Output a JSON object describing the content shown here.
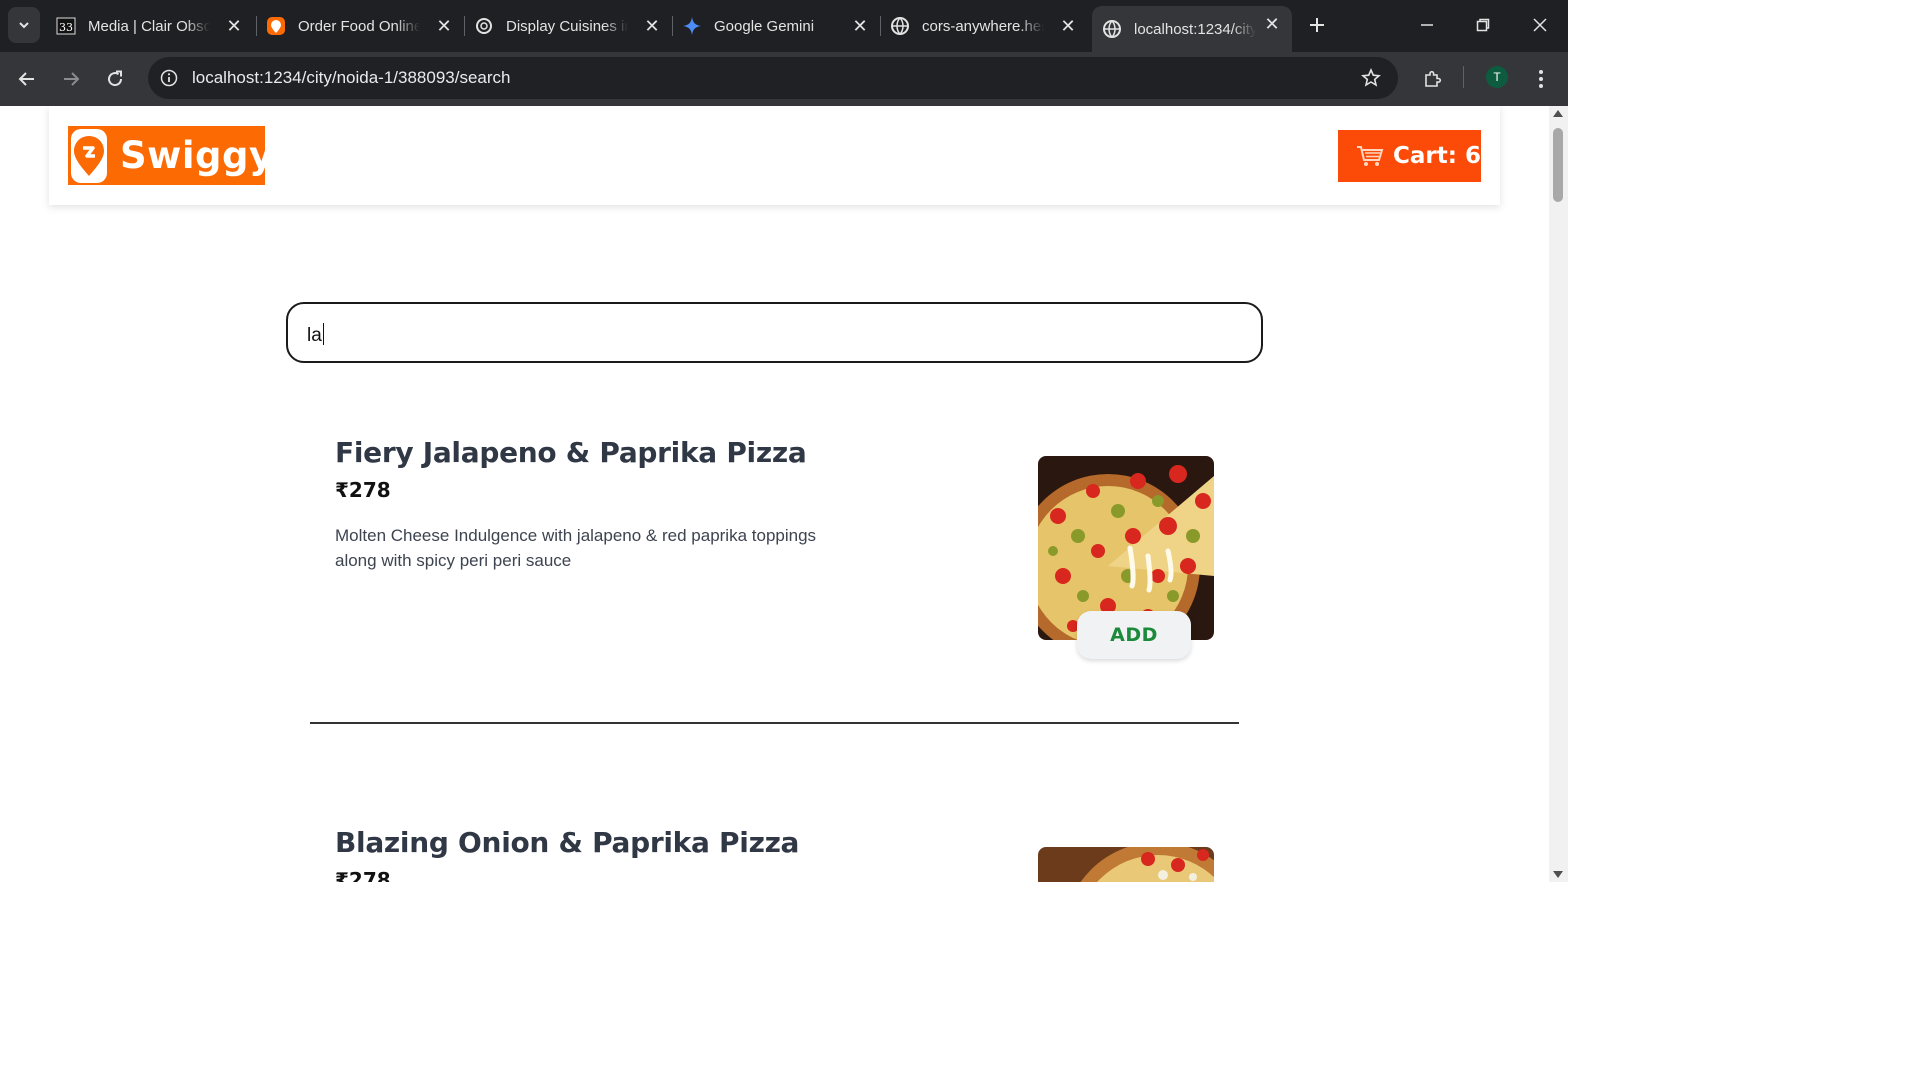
{
  "browser": {
    "tabs": [
      {
        "title": "Media | Clair Obscur",
        "icon": "clair-obscur-favicon"
      },
      {
        "title": "Order Food Online",
        "icon": "swiggy-favicon"
      },
      {
        "title": "Display Cuisines in",
        "icon": "chatgpt-favicon"
      },
      {
        "title": "Google Gemini",
        "icon": "gemini-favicon"
      },
      {
        "title": "cors-anywhere.herokuapp",
        "icon": "globe-favicon"
      },
      {
        "title": "localhost:1234/city",
        "icon": "globe-favicon",
        "active": true
      }
    ],
    "url": "localhost:1234/city/noida-1/388093/search",
    "profile_initial": "T"
  },
  "header": {
    "logo_text": "Swiggy",
    "cart_label": "Cart: 6",
    "brand_color": "#fc6a03",
    "cart_color": "#fc4b08"
  },
  "search": {
    "value": "la"
  },
  "items": [
    {
      "name": "Fiery Jalapeno & Paprika Pizza",
      "price": "₹278",
      "description": "Molten Cheese Indulgence with jalapeno & red paprika toppings along with spicy peri peri sauce",
      "add_label": "ADD"
    },
    {
      "name": "Blazing Onion & Paprika Pizza",
      "price": "₹278"
    }
  ]
}
